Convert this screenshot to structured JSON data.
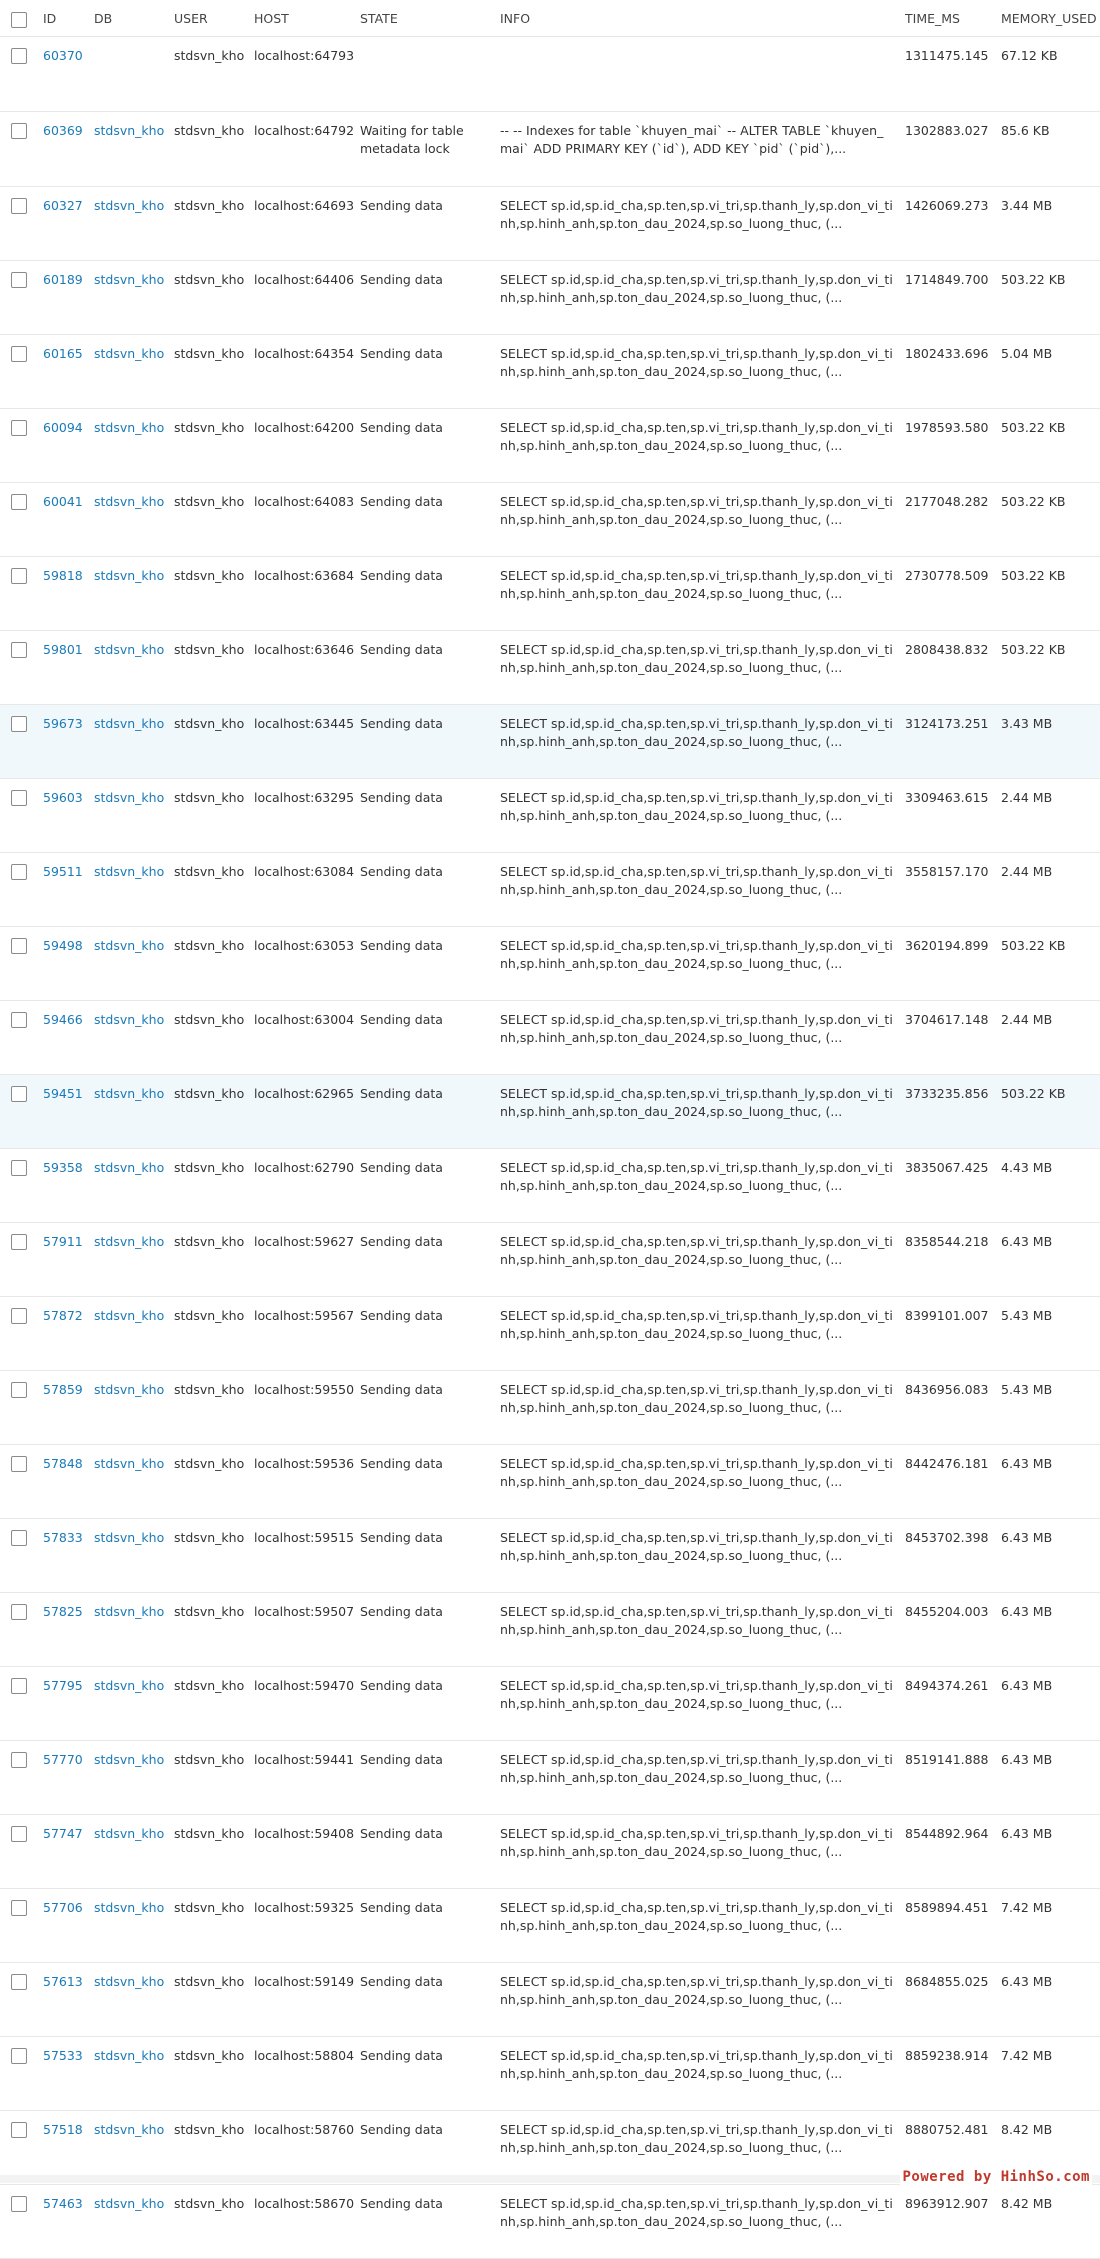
{
  "columns": {
    "id": "ID",
    "db": "DB",
    "user": "USER",
    "host": "HOST",
    "state": "STATE",
    "info": "INFO",
    "time": "TIME_MS",
    "memory": "MEMORY_USED"
  },
  "info_select": "SELECT sp.id,sp.id_cha,sp.ten,sp.vi_tri,sp.thanh_ly,sp.don_vi_tinh,sp.hinh_anh,sp.ton_dau_2024,sp.so_luong_thuc, (...",
  "rows": [
    {
      "id": "60370",
      "db": "",
      "user": "stdsvn_kho",
      "host": "localhost:64793",
      "state": "",
      "info": "",
      "time": "1311475.145",
      "memory": "67.12 KB"
    },
    {
      "id": "60369",
      "db": "stdsvn_kho",
      "user": "stdsvn_kho",
      "host": "localhost:64792",
      "state": "Waiting for table metadata lock",
      "info": "-- -- Indexes for table `khuyen_mai` -- ALTER TABLE `khuyen_mai` ADD PRIMARY KEY (`id`), ADD KEY `pid` (`pid`),...",
      "time": "1302883.027",
      "memory": "85.6 KB"
    },
    {
      "id": "60327",
      "db": "stdsvn_kho",
      "user": "stdsvn_kho",
      "host": "localhost:64693",
      "state": "Sending data",
      "info": "",
      "time": "1426069.273",
      "memory": "3.44 MB"
    },
    {
      "id": "60189",
      "db": "stdsvn_kho",
      "user": "stdsvn_kho",
      "host": "localhost:64406",
      "state": "Sending data",
      "info": "",
      "time": "1714849.700",
      "memory": "503.22 KB"
    },
    {
      "id": "60165",
      "db": "stdsvn_kho",
      "user": "stdsvn_kho",
      "host": "localhost:64354",
      "state": "Sending data",
      "info": "",
      "time": "1802433.696",
      "memory": "5.04 MB"
    },
    {
      "id": "60094",
      "db": "stdsvn_kho",
      "user": "stdsvn_kho",
      "host": "localhost:64200",
      "state": "Sending data",
      "info": "",
      "time": "1978593.580",
      "memory": "503.22 KB"
    },
    {
      "id": "60041",
      "db": "stdsvn_kho",
      "user": "stdsvn_kho",
      "host": "localhost:64083",
      "state": "Sending data",
      "info": "",
      "time": "2177048.282",
      "memory": "503.22 KB"
    },
    {
      "id": "59818",
      "db": "stdsvn_kho",
      "user": "stdsvn_kho",
      "host": "localhost:63684",
      "state": "Sending data",
      "info": "",
      "time": "2730778.509",
      "memory": "503.22 KB"
    },
    {
      "id": "59801",
      "db": "stdsvn_kho",
      "user": "stdsvn_kho",
      "host": "localhost:63646",
      "state": "Sending data",
      "info": "",
      "time": "2808438.832",
      "memory": "503.22 KB"
    },
    {
      "id": "59673",
      "db": "stdsvn_kho",
      "user": "stdsvn_kho",
      "host": "localhost:63445",
      "state": "Sending data",
      "info": "",
      "time": "3124173.251",
      "memory": "3.43 MB",
      "highlight": true
    },
    {
      "id": "59603",
      "db": "stdsvn_kho",
      "user": "stdsvn_kho",
      "host": "localhost:63295",
      "state": "Sending data",
      "info": "",
      "time": "3309463.615",
      "memory": "2.44 MB"
    },
    {
      "id": "59511",
      "db": "stdsvn_kho",
      "user": "stdsvn_kho",
      "host": "localhost:63084",
      "state": "Sending data",
      "info": "",
      "time": "3558157.170",
      "memory": "2.44 MB"
    },
    {
      "id": "59498",
      "db": "stdsvn_kho",
      "user": "stdsvn_kho",
      "host": "localhost:63053",
      "state": "Sending data",
      "info": "",
      "time": "3620194.899",
      "memory": "503.22 KB"
    },
    {
      "id": "59466",
      "db": "stdsvn_kho",
      "user": "stdsvn_kho",
      "host": "localhost:63004",
      "state": "Sending data",
      "info": "",
      "time": "3704617.148",
      "memory": "2.44 MB"
    },
    {
      "id": "59451",
      "db": "stdsvn_kho",
      "user": "stdsvn_kho",
      "host": "localhost:62965",
      "state": "Sending data",
      "info": "",
      "time": "3733235.856",
      "memory": "503.22 KB",
      "highlight": true
    },
    {
      "id": "59358",
      "db": "stdsvn_kho",
      "user": "stdsvn_kho",
      "host": "localhost:62790",
      "state": "Sending data",
      "info": "",
      "time": "3835067.425",
      "memory": "4.43 MB"
    },
    {
      "id": "57911",
      "db": "stdsvn_kho",
      "user": "stdsvn_kho",
      "host": "localhost:59627",
      "state": "Sending data",
      "info": "",
      "time": "8358544.218",
      "memory": "6.43 MB"
    },
    {
      "id": "57872",
      "db": "stdsvn_kho",
      "user": "stdsvn_kho",
      "host": "localhost:59567",
      "state": "Sending data",
      "info": "",
      "time": "8399101.007",
      "memory": "5.43 MB"
    },
    {
      "id": "57859",
      "db": "stdsvn_kho",
      "user": "stdsvn_kho",
      "host": "localhost:59550",
      "state": "Sending data",
      "info": "",
      "time": "8436956.083",
      "memory": "5.43 MB"
    },
    {
      "id": "57848",
      "db": "stdsvn_kho",
      "user": "stdsvn_kho",
      "host": "localhost:59536",
      "state": "Sending data",
      "info": "",
      "time": "8442476.181",
      "memory": "6.43 MB"
    },
    {
      "id": "57833",
      "db": "stdsvn_kho",
      "user": "stdsvn_kho",
      "host": "localhost:59515",
      "state": "Sending data",
      "info": "",
      "time": "8453702.398",
      "memory": "6.43 MB"
    },
    {
      "id": "57825",
      "db": "stdsvn_kho",
      "user": "stdsvn_kho",
      "host": "localhost:59507",
      "state": "Sending data",
      "info": "",
      "time": "8455204.003",
      "memory": "6.43 MB"
    },
    {
      "id": "57795",
      "db": "stdsvn_kho",
      "user": "stdsvn_kho",
      "host": "localhost:59470",
      "state": "Sending data",
      "info": "",
      "time": "8494374.261",
      "memory": "6.43 MB"
    },
    {
      "id": "57770",
      "db": "stdsvn_kho",
      "user": "stdsvn_kho",
      "host": "localhost:59441",
      "state": "Sending data",
      "info": "",
      "time": "8519141.888",
      "memory": "6.43 MB"
    },
    {
      "id": "57747",
      "db": "stdsvn_kho",
      "user": "stdsvn_kho",
      "host": "localhost:59408",
      "state": "Sending data",
      "info": "",
      "time": "8544892.964",
      "memory": "6.43 MB"
    },
    {
      "id": "57706",
      "db": "stdsvn_kho",
      "user": "stdsvn_kho",
      "host": "localhost:59325",
      "state": "Sending data",
      "info": "",
      "time": "8589894.451",
      "memory": "7.42 MB"
    },
    {
      "id": "57613",
      "db": "stdsvn_kho",
      "user": "stdsvn_kho",
      "host": "localhost:59149",
      "state": "Sending data",
      "info": "",
      "time": "8684855.025",
      "memory": "6.43 MB"
    },
    {
      "id": "57533",
      "db": "stdsvn_kho",
      "user": "stdsvn_kho",
      "host": "localhost:58804",
      "state": "Sending data",
      "info": "",
      "time": "8859238.914",
      "memory": "7.42 MB"
    },
    {
      "id": "57518",
      "db": "stdsvn_kho",
      "user": "stdsvn_kho",
      "host": "localhost:58760",
      "state": "Sending data",
      "info": "",
      "time": "8880752.481",
      "memory": "8.42 MB"
    },
    {
      "id": "57463",
      "db": "stdsvn_kho",
      "user": "stdsvn_kho",
      "host": "localhost:58670",
      "state": "Sending data",
      "info": "",
      "time": "8963912.907",
      "memory": "8.42 MB"
    }
  ],
  "watermark": "Powered by HinhSo.com",
  "colors": {
    "link": "#1a7ab8",
    "row_highlight": "#f1f8fc",
    "watermark": "#c0392b"
  }
}
